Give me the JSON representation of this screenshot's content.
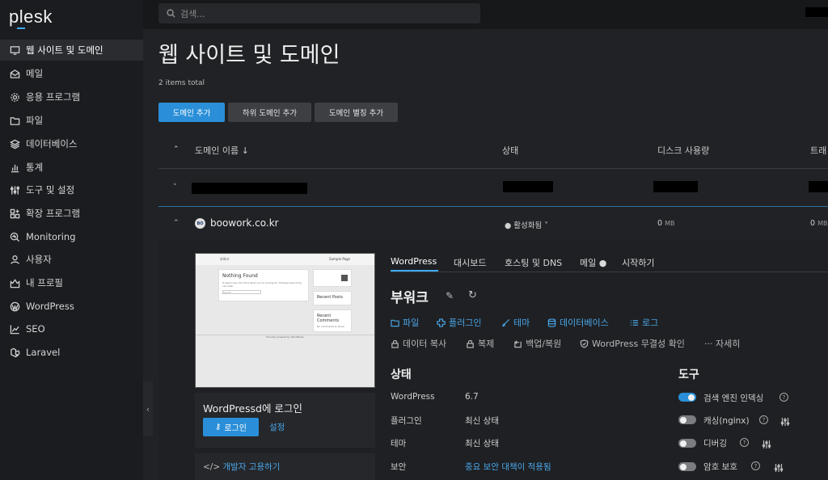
{
  "app": {
    "logo": "plesk"
  },
  "search": {
    "placeholder": "검색..."
  },
  "sidebar": {
    "items": [
      {
        "label": "웹 사이트 및 도메인",
        "icon": "monitor-icon"
      },
      {
        "label": "메일",
        "icon": "mail-icon"
      },
      {
        "label": "응용 프로그램",
        "icon": "gear-icon"
      },
      {
        "label": "파일",
        "icon": "folder-icon"
      },
      {
        "label": "데이터베이스",
        "icon": "layers-icon"
      },
      {
        "label": "통계",
        "icon": "bar-chart-icon"
      },
      {
        "label": "도구 및 설정",
        "icon": "sliders-icon"
      },
      {
        "label": "확장 프로그램",
        "icon": "grid-icon"
      },
      {
        "label": "Monitoring",
        "icon": "monitoring-icon"
      },
      {
        "label": "사용자",
        "icon": "user-icon"
      },
      {
        "label": "내 프로필",
        "icon": "profile-icon"
      },
      {
        "label": "WordPress",
        "icon": "wordpress-icon"
      },
      {
        "label": "SEO",
        "icon": "seo-icon"
      },
      {
        "label": "Laravel",
        "icon": "laravel-icon"
      }
    ]
  },
  "page": {
    "title": "웹 사이트 및 도메인",
    "count": "2 items total",
    "buttons": {
      "add_domain": "도메인 추가",
      "add_subdomain": "하위 도메인 추가",
      "add_alias": "도메인 별칭 추가"
    }
  },
  "table": {
    "headers": {
      "name": "도메인 이름 ↓",
      "status": "상태",
      "disk": "디스크 사용량",
      "traffic": "트래"
    },
    "rows": [
      {
        "name": "",
        "status": "",
        "disk": "",
        "traffic": ""
      },
      {
        "name": "boowork.co.kr",
        "status": "● 활성화됨 ˅",
        "disk": "0",
        "disk_unit": "MB",
        "traffic": "0",
        "traffic_unit": "MB"
      }
    ]
  },
  "details": {
    "preview": {
      "header_left": "부워크",
      "header_right": "Sample Page",
      "nothing_found": "Nothing Found",
      "nothing_text": "It seems we can't find what you're looking for. Perhaps searching can help.",
      "search_hint": "Search ...",
      "recent_posts": "Recent Posts",
      "recent_comments": "Recent Comments",
      "no_comments": "No comments to show.",
      "footer": "Proudly powered by WordPress"
    },
    "login_title": "WordPressd에 로그인",
    "login_button": "로그인",
    "settings_link": "설정",
    "dev_link": "개발자 고용하기",
    "tabs": [
      "WordPress",
      "대시보드",
      "호스팅 및 DNS",
      "메일 ●",
      "시작하기"
    ],
    "site_title": "부워크",
    "links_row1": [
      "파일",
      "플러그인",
      "테마",
      "데이터베이스",
      "로그"
    ],
    "links_row2": [
      "데이터 복사",
      "복제",
      "백업/복원",
      "WordPress 무결성 확인",
      "··· 자세히"
    ],
    "status": {
      "title": "상태",
      "rows": [
        {
          "key": "WordPress",
          "value": "6.7"
        },
        {
          "key": "플러그인",
          "value": "최신 상태"
        },
        {
          "key": "테마",
          "value": "최신 상태"
        },
        {
          "key": "보안",
          "value": "중요 보안 대책이 적용됨"
        }
      ]
    },
    "tools": {
      "title": "도구",
      "items": [
        {
          "label": "검색 엔진 인덱싱",
          "on": true
        },
        {
          "label": "캐싱(nginx)",
          "on": false
        },
        {
          "label": "디버깅",
          "on": false
        },
        {
          "label": "암호 보호",
          "on": false
        }
      ]
    }
  },
  "colors": {
    "accent": "#2a8fd8",
    "link": "#4aa6e8",
    "bg": "#202225",
    "sidebar": "#1b1c1f"
  }
}
